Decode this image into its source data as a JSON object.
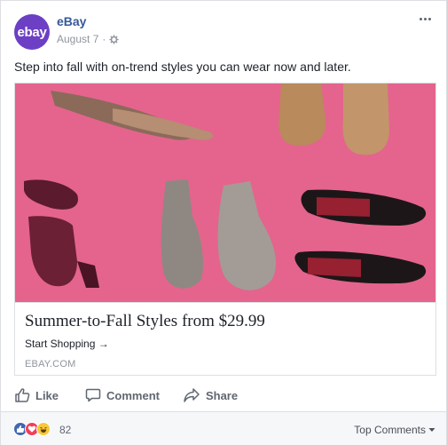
{
  "post": {
    "page_name": "eBay",
    "avatar_text": "ebay",
    "date": "August 7",
    "meta_separator": "·",
    "text": "Step into fall with on-trend styles you can wear now and later."
  },
  "attachment": {
    "image_subject": "shoes on pink background",
    "title": "Summer-to-Fall Styles from $29.99",
    "cta": "Start Shopping →",
    "domain": "EBAY.COM"
  },
  "actions": {
    "like": "Like",
    "comment": "Comment",
    "share": "Share"
  },
  "reactions": {
    "types": [
      "like",
      "love",
      "haha"
    ],
    "count": "82"
  },
  "comments_filter": {
    "label": "Top Comments"
  },
  "colors": {
    "brand_avatar": "#6c3fc4",
    "link_blue": "#365899",
    "image_background": "#e8678f",
    "like_blue": "#4267b2",
    "love_red": "#f33e58",
    "haha_yellow": "#f7c83a"
  }
}
